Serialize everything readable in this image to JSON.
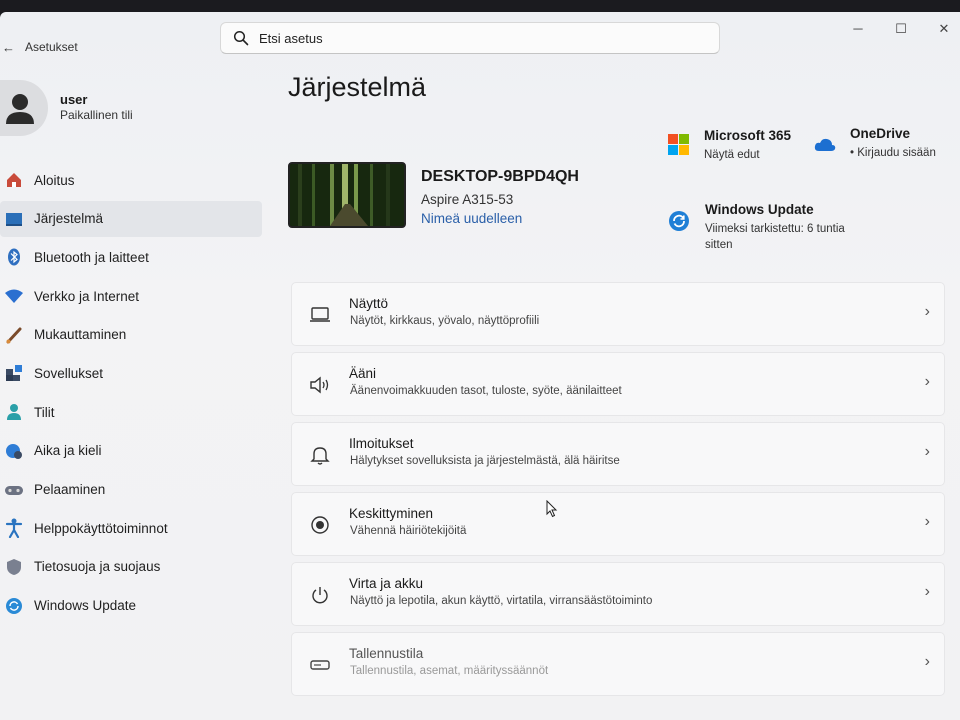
{
  "titlebar": {
    "back_icon": "back-arrow-icon",
    "app_title": "Asetukset",
    "search_placeholder": "Etsi asetus",
    "minimize": "─",
    "maximize": "☐",
    "close": "✕"
  },
  "user": {
    "name": "user",
    "account_type": "Paikallinen tili"
  },
  "sidebar": {
    "items": [
      {
        "label": "Aloitus",
        "icon": "home-icon",
        "active": false
      },
      {
        "label": "Järjestelmä",
        "icon": "system-icon",
        "active": true
      },
      {
        "label": "Bluetooth ja laitteet",
        "icon": "bluetooth-icon",
        "active": false
      },
      {
        "label": "Verkko ja Internet",
        "icon": "wifi-icon",
        "active": false
      },
      {
        "label": "Mukauttaminen",
        "icon": "brush-icon",
        "active": false
      },
      {
        "label": "Sovellukset",
        "icon": "apps-icon",
        "active": false
      },
      {
        "label": "Tilit",
        "icon": "account-icon",
        "active": false
      },
      {
        "label": "Aika ja kieli",
        "icon": "globe-clock-icon",
        "active": false
      },
      {
        "label": "Pelaaminen",
        "icon": "gamepad-icon",
        "active": false
      },
      {
        "label": "Helppokäyttötoiminnot",
        "icon": "accessibility-icon",
        "active": false
      },
      {
        "label": "Tietosuoja ja suojaus",
        "icon": "shield-icon",
        "active": false
      },
      {
        "label": "Windows Update",
        "icon": "update-icon",
        "active": false
      }
    ]
  },
  "main": {
    "page_title": "Järjestelmä",
    "device": {
      "name": "DESKTOP-9BPD4QH",
      "model": "Aspire A315-53",
      "rename_link": "Nimeä uudelleen"
    },
    "tiles": {
      "microsoft365": {
        "title": "Microsoft 365",
        "sub": "Näytä edut",
        "icon": "microsoft-logo-icon"
      },
      "onedrive": {
        "title": "OneDrive",
        "sub": "• Kirjaudu sisään",
        "icon": "onedrive-cloud-icon"
      },
      "windows_update": {
        "title": "Windows Update",
        "sub": "Viimeksi tarkistettu: 6 tuntia sitten",
        "icon": "update-icon"
      }
    },
    "cards": [
      {
        "title": "Näyttö",
        "sub": "Näytöt, kirkkaus, yövalo, näyttöprofiili",
        "icon": "monitor-icon"
      },
      {
        "title": "Ääni",
        "sub": "Äänenvoimakkuuden tasot, tuloste, syöte, äänilaitteet",
        "icon": "speaker-icon"
      },
      {
        "title": "Ilmoitukset",
        "sub": "Hälytykset sovelluksista ja järjestelmästä, älä häiritse",
        "icon": "bell-icon"
      },
      {
        "title": "Keskittyminen",
        "sub": "Vähennä häiriötekijöitä",
        "icon": "focus-icon"
      },
      {
        "title": "Virta ja akku",
        "sub": "Näyttö ja lepotila, akun käyttö, virtatila, virransäästötoiminto",
        "icon": "power-icon"
      },
      {
        "title": "Tallennustila",
        "sub": "Tallennustila, asemat, määrityssäännöt",
        "icon": "storage-icon"
      }
    ],
    "chevron": "›"
  },
  "colors": {
    "accent": "#2a5fa8",
    "window_bg": "#f2f2f3",
    "card_bg": "#f8f8f9",
    "active_nav": "#e3e5e9"
  }
}
